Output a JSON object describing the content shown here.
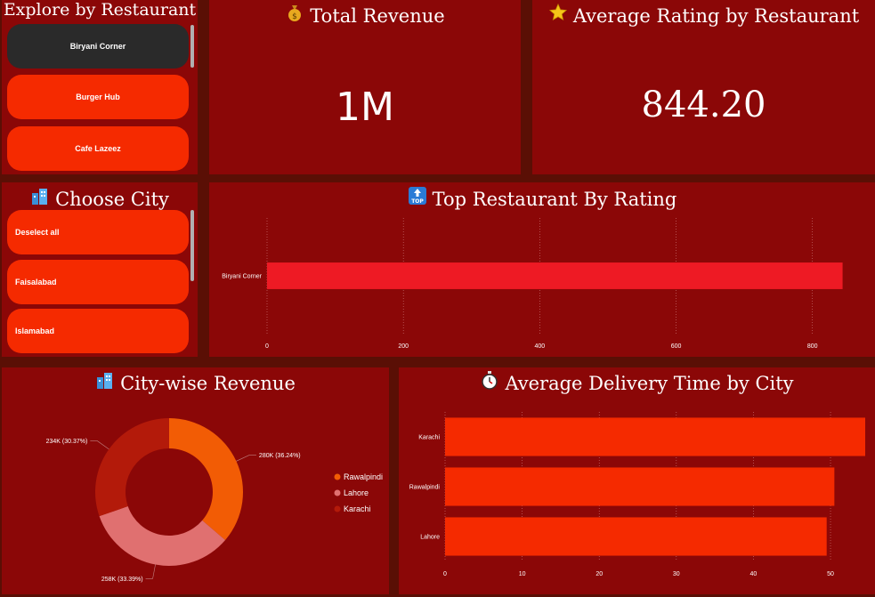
{
  "restaurant_slicer": {
    "title": "Explore by Restaurant",
    "items": [
      {
        "label": "Biryani Corner",
        "selected": true
      },
      {
        "label": "Burger Hub",
        "selected": false
      },
      {
        "label": "Cafe Lazeez",
        "selected": false
      }
    ]
  },
  "kpi_revenue": {
    "icon": "money-bag-icon",
    "title": "Total Revenue",
    "value": "1M"
  },
  "kpi_rating": {
    "icon": "star-icon",
    "title": "Average Rating by Restaurant",
    "value": "844.20"
  },
  "city_slicer": {
    "icon": "city-icon",
    "title": "Choose City",
    "items": [
      {
        "label": "Deselect all"
      },
      {
        "label": "Faisalabad"
      },
      {
        "label": "Islamabad"
      }
    ]
  },
  "colors": {
    "panel_bg": "#8b0707",
    "page_bg": "#5a0f05",
    "button": "#f52a00",
    "button_selected": "#2a2a2a",
    "rating_bar": "#ee1a24",
    "delivery_bar": "#f52a00",
    "rawalpindi": "#f25c05",
    "lahore": "#e07070",
    "karachi": "#b31a0a"
  },
  "chart_data": [
    {
      "type": "bar",
      "orientation": "horizontal",
      "icon": "top-arrow-icon",
      "title": "Top Restaurant By Rating",
      "categories": [
        "Biryani Corner"
      ],
      "values": [
        844.2
      ],
      "xlim": [
        0,
        880
      ],
      "xticks": [
        0,
        200,
        400,
        600,
        800
      ]
    },
    {
      "type": "pie",
      "donut": true,
      "icon": "city-icon",
      "title": "City-wise Revenue",
      "slices": [
        {
          "name": "Rawalpindi",
          "value": 280,
          "label": "280K (36.24%)"
        },
        {
          "name": "Lahore",
          "value": 258,
          "label": "258K (33.39%)"
        },
        {
          "name": "Karachi",
          "value": 234,
          "label": "234K (30.37%)"
        }
      ],
      "legend": [
        "Rawalpindi",
        "Lahore",
        "Karachi"
      ],
      "legend_position": "right"
    },
    {
      "type": "bar",
      "orientation": "horizontal",
      "icon": "stopwatch-icon",
      "title": "Average Delivery Time by City",
      "categories": [
        "Karachi",
        "Rawalpindi",
        "Lahore"
      ],
      "values": [
        54.5,
        50.5,
        49.5
      ],
      "xlim": [
        0,
        54.5
      ],
      "xticks": [
        0,
        10,
        20,
        30,
        40,
        50
      ]
    }
  ]
}
